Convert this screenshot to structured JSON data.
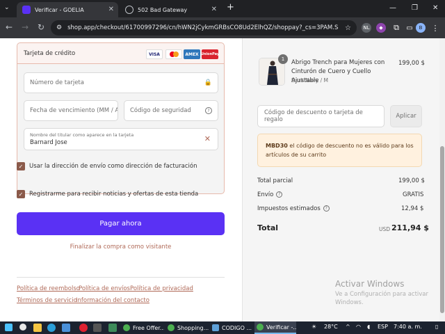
{
  "browser": {
    "tabs": [
      {
        "title": "Verificar - GOELIA",
        "active": true
      },
      {
        "title": "502 Bad Gateway",
        "active": false
      }
    ],
    "new_tab": "+",
    "url": "shop.app/checkout/61700997296/cn/hWN2jCykmGRBsCO8Ud2ElhQZ/shoppay?_cs=3PAM.S&red...",
    "profile_badge": "NL",
    "avatar_letter": "B"
  },
  "payment": {
    "method_label": "Tarjeta de crédito",
    "brands": [
      "VISA",
      "",
      "AMEX",
      "UnionPay"
    ],
    "card_number_placeholder": "Número de tarjeta",
    "expiry_placeholder": "Fecha de vencimiento (MM / AA)",
    "cvv_placeholder": "Código de seguridad",
    "name_label": "Nombre del titular como aparece en la tarjeta",
    "name_value": "Barnard Jose",
    "billing_checkbox": "Usar la dirección de envío como dirección de facturación",
    "news_checkbox": "Registrarme para recibir noticias y ofertas de esta tienda",
    "pay_button": "Pagar ahora",
    "guest_link": "Finalizar la compra como visitante"
  },
  "footer_links": [
    "Política de reembolso",
    "Política de envíos",
    "Política de privacidad",
    "Términos de servicio",
    "Información del contacto"
  ],
  "summary": {
    "item": {
      "quantity": "1",
      "name": "Abrigo Trench para Mujeres con Cinturón de Cuero y Cuello Ajustable",
      "variant": "Dark Navy / M",
      "price": "199,00 $"
    },
    "discount_placeholder": "Código de descuento o tarjeta de regalo",
    "apply_button": "Aplicar",
    "error_code": "MBD30",
    "error_text": " el código de descuento no es válido para los artículos de su carrito",
    "subtotal_label": "Total parcial",
    "subtotal_value": "199,00 $",
    "shipping_label": "Envío",
    "shipping_value": "GRATIS",
    "tax_label": "Impuestos estimados",
    "tax_value": "12,94 $",
    "total_label": "Total",
    "currency": "USD",
    "total_value": "211,94 $"
  },
  "watermark": {
    "title": "Activar Windows",
    "text": "Ve a Configuración para activar Windows."
  },
  "taskbar": {
    "apps": [
      "Free Offer...",
      "Shopping...",
      "CODIGO ...",
      "Verificar -..."
    ],
    "temperature": "28°C",
    "language": "ESP",
    "time": "7:40 a. m."
  },
  "colors": {
    "accent": "#5a31f4",
    "link": "#b06a58",
    "checkbox": "#8b5a4a"
  }
}
